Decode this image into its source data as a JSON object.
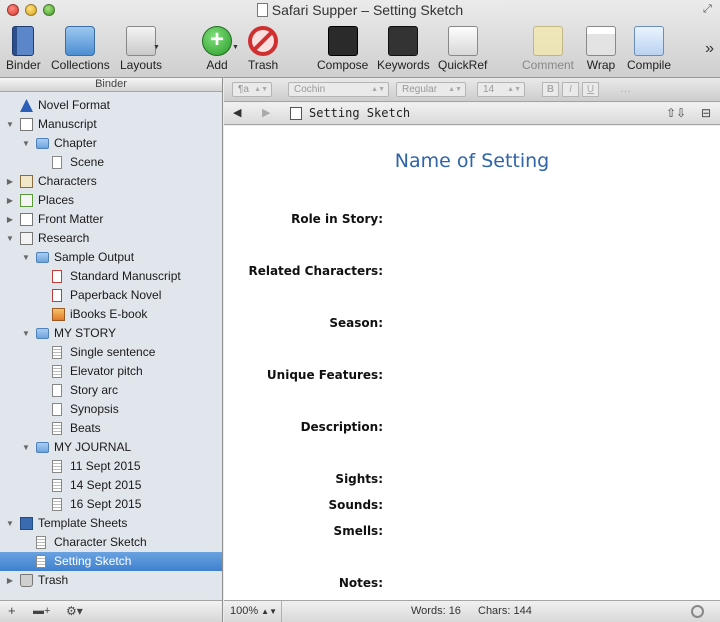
{
  "window": {
    "title": "Safari Supper – Setting Sketch"
  },
  "toolbar": {
    "binder_label": "Binder",
    "collections_label": "Collections",
    "layouts_label": "Layouts",
    "add_label": "Add",
    "trash_label": "Trash",
    "compose_label": "Compose",
    "keywords_label": "Keywords",
    "quickref_label": "QuickRef",
    "comment_label": "Comment",
    "wrap_label": "Wrap",
    "compile_label": "Compile",
    "overflow_glyph": "»"
  },
  "binder": {
    "header": "Binder",
    "items": [
      {
        "label": "Novel Format",
        "icon": "info-icon",
        "level": 0,
        "disclosure": ""
      },
      {
        "label": "Manuscript",
        "icon": "manuscript-icon",
        "level": 0,
        "disclosure": "▼"
      },
      {
        "label": "Chapter",
        "icon": "folder-icon",
        "level": 1,
        "disclosure": "▼"
      },
      {
        "label": "Scene",
        "icon": "document-icon",
        "level": 2,
        "disclosure": ""
      },
      {
        "label": "Characters",
        "icon": "characters-icon",
        "level": 0,
        "disclosure": "▶"
      },
      {
        "label": "Places",
        "icon": "places-icon",
        "level": 0,
        "disclosure": "▶"
      },
      {
        "label": "Front Matter",
        "icon": "front-matter-icon",
        "level": 0,
        "disclosure": "▶"
      },
      {
        "label": "Research",
        "icon": "research-icon",
        "level": 0,
        "disclosure": "▼"
      },
      {
        "label": "Sample Output",
        "icon": "folder-icon",
        "level": 1,
        "disclosure": "▼"
      },
      {
        "label": "Standard Manuscript",
        "icon": "pdf-icon",
        "level": 2,
        "disclosure": ""
      },
      {
        "label": "Paperback Novel",
        "icon": "pdf-icon",
        "level": 2,
        "disclosure": ""
      },
      {
        "label": "iBooks E-book",
        "icon": "image-icon",
        "level": 2,
        "disclosure": ""
      },
      {
        "label": "MY STORY",
        "icon": "folder-icon",
        "level": 1,
        "disclosure": "▼"
      },
      {
        "label": "Single sentence",
        "icon": "text-sheet-icon",
        "level": 2,
        "disclosure": ""
      },
      {
        "label": "Elevator pitch",
        "icon": "text-sheet-icon",
        "level": 2,
        "disclosure": ""
      },
      {
        "label": "Story arc",
        "icon": "document-icon",
        "level": 2,
        "disclosure": ""
      },
      {
        "label": "Synopsis",
        "icon": "document-icon",
        "level": 2,
        "disclosure": ""
      },
      {
        "label": "Beats",
        "icon": "text-sheet-icon",
        "level": 2,
        "disclosure": ""
      },
      {
        "label": "MY JOURNAL",
        "icon": "folder-icon",
        "level": 1,
        "disclosure": "▼"
      },
      {
        "label": "11 Sept 2015",
        "icon": "text-sheet-icon",
        "level": 2,
        "disclosure": ""
      },
      {
        "label": "14 Sept 2015",
        "icon": "text-sheet-icon",
        "level": 2,
        "disclosure": ""
      },
      {
        "label": "16 Sept 2015",
        "icon": "text-sheet-icon",
        "level": 2,
        "disclosure": ""
      },
      {
        "label": "Template Sheets",
        "icon": "template-icon",
        "level": 0,
        "disclosure": "▼"
      },
      {
        "label": "Character Sketch",
        "icon": "sketch-icon",
        "level": 1,
        "disclosure": ""
      },
      {
        "label": "Setting Sketch",
        "icon": "sketch-icon",
        "level": 1,
        "disclosure": "",
        "selected": true
      },
      {
        "label": "Trash",
        "icon": "trash-icon",
        "level": 0,
        "disclosure": "▶"
      }
    ],
    "footer": {
      "add_glyph": "+",
      "folder_glyph": "▬+",
      "gear_glyph": "⚙▾"
    }
  },
  "formatbar": {
    "paragraph_style": "¶a",
    "font": "Cochin",
    "weight": "Regular",
    "size": "14",
    "bold": "B",
    "italic": "I",
    "underline": "U",
    "more": "…"
  },
  "editor_header": {
    "back_glyph": "◀",
    "forward_glyph": "▶",
    "doc_title": "Setting Sketch",
    "up_down_glyph": "⇧⇩",
    "split_glyph": "⊟"
  },
  "document": {
    "heading": "Name of Setting",
    "fields": [
      "Role in Story:",
      "Related Characters:",
      "Season:",
      "Unique Features:",
      "Description:",
      "Sights:",
      "Sounds:",
      "Smells:",
      "Notes:"
    ]
  },
  "statusbar": {
    "zoom": "100%",
    "words": "Words: 16",
    "chars": "Chars: 144"
  }
}
